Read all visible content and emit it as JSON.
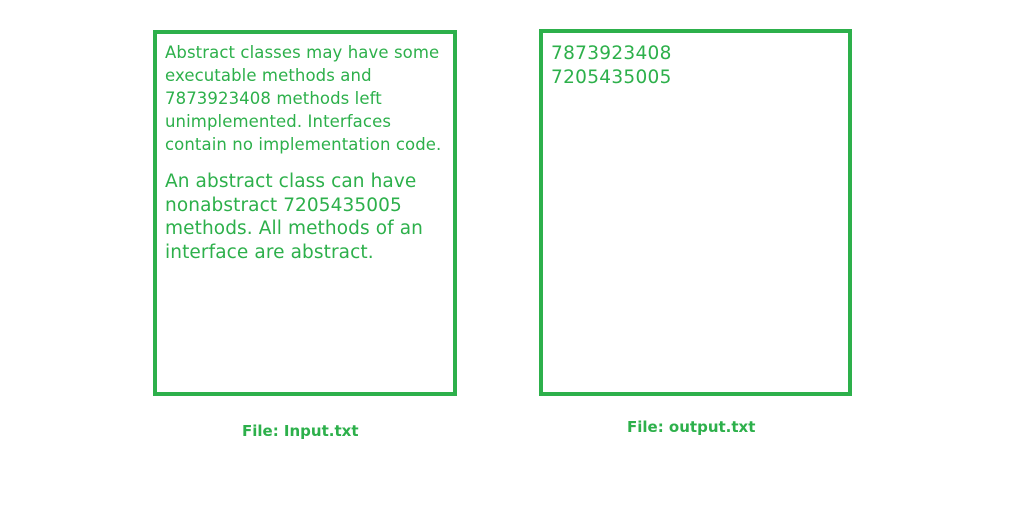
{
  "input_file": {
    "caption": "File: Input.txt",
    "paragraph_1": "Abstract classes may have some executable methods and 7873923408 methods left unimplemented. Interfaces contain no implementation code.",
    "paragraph_2": "An abstract class can have nonabstract 7205435005 methods. All methods of an interface are abstract."
  },
  "output_file": {
    "caption": "File: output.txt",
    "lines": [
      "7873923408",
      "7205435005"
    ]
  },
  "colors": {
    "accent": "#2db04b",
    "background": "#ffffff"
  }
}
